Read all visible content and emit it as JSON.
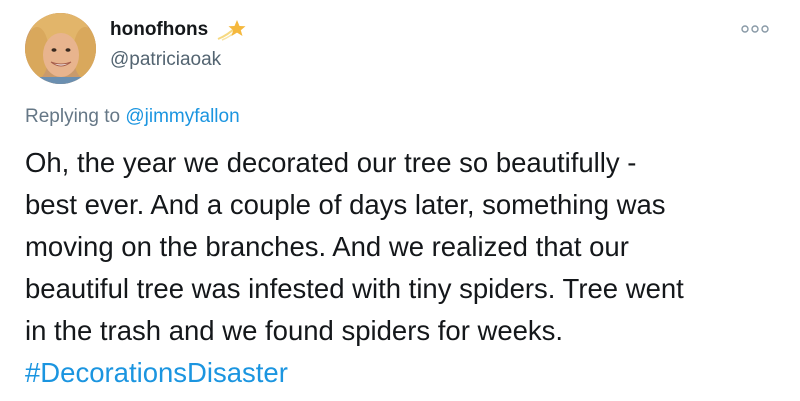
{
  "user": {
    "display_name": "honofhons",
    "handle": "@patriciaoak",
    "name_emoji": "shooting-star-icon"
  },
  "reply": {
    "prefix": "Replying to",
    "mention": "@jimmyfallon"
  },
  "tweet": {
    "text": "Oh, the year we decorated our tree so beautifully -\nbest ever. And a couple of days later, something was\nmoving on the branches. And we realized that our\nbeautiful tree was infested with tiny spiders. Tree went\nin the trash and we found spiders for weeks.",
    "hashtag": "#DecorationsDisaster"
  },
  "icons": {
    "more": "more-options-icon"
  },
  "colors": {
    "text": "#14171a",
    "secondary": "#657786",
    "link": "#1b95e0",
    "background": "#ffffff"
  }
}
